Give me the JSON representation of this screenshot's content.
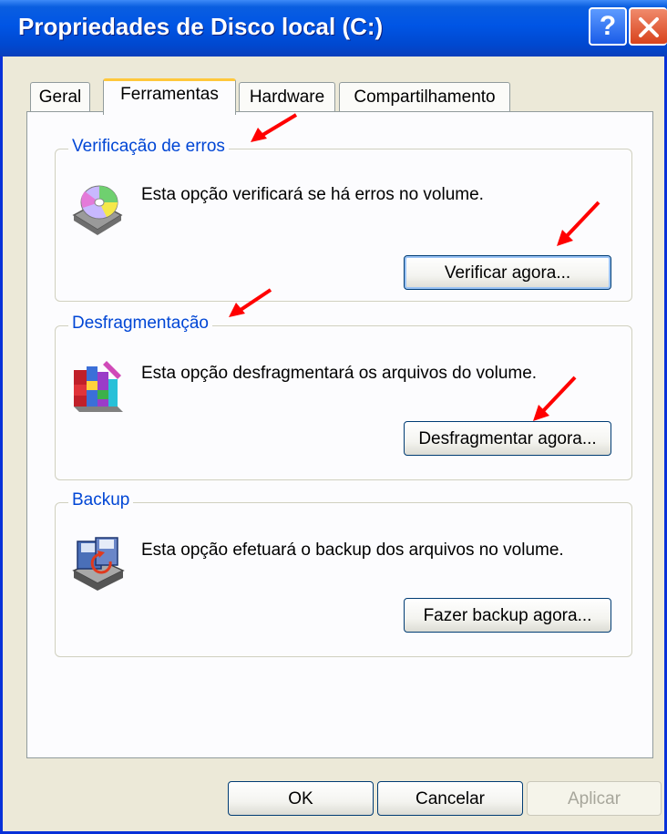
{
  "window": {
    "title": "Propriedades de Disco local (C:)",
    "help_glyph": "?"
  },
  "tabs": [
    {
      "label": "Geral",
      "active": false
    },
    {
      "label": "Ferramentas",
      "active": true
    },
    {
      "label": "Hardware",
      "active": false
    },
    {
      "label": "Compartilhamento",
      "active": false
    }
  ],
  "groups": {
    "error_check": {
      "label": "Verificação de erros",
      "description": "Esta opção verificará se há erros no volume.",
      "button": "Verificar agora...",
      "icon": "disk-check-icon"
    },
    "defrag": {
      "label": "Desfragmentação",
      "description": "Esta opção desfragmentará os arquivos do volume.",
      "button": "Desfragmentar agora...",
      "icon": "defrag-icon"
    },
    "backup": {
      "label": "Backup",
      "description": "Esta opção efetuará o backup dos arquivos no volume.",
      "button": "Fazer backup agora...",
      "icon": "backup-icon"
    }
  },
  "footer": {
    "ok": "OK",
    "cancel": "Cancelar",
    "apply": "Aplicar",
    "apply_enabled": false
  },
  "colors": {
    "accent": "#0046d5",
    "annotation_arrow": "#ff0000",
    "titlebar": "#0055e5",
    "dialog_bg": "#ece9d8"
  }
}
